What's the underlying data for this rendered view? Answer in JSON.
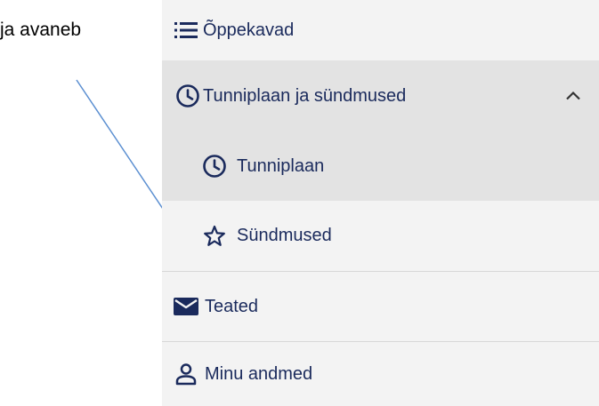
{
  "annotation": {
    "text": "ja avaneb"
  },
  "menu": {
    "items": [
      {
        "label": "Õppekavad",
        "icon": "list-icon"
      },
      {
        "label": "Tunniplaan ja sündmused",
        "icon": "clock-icon",
        "expanded": true
      },
      {
        "label": "Tunniplaan",
        "icon": "clock-icon"
      },
      {
        "label": "Sündmused",
        "icon": "star-icon"
      },
      {
        "label": "Teated",
        "icon": "envelope-icon"
      },
      {
        "label": "Minu andmed",
        "icon": "person-icon"
      }
    ]
  },
  "colors": {
    "menu_text": "#1a2a5c",
    "menu_bg": "#f3f3f3",
    "active_bg": "#e3e3e3",
    "arrow": "#5b8fd1"
  }
}
